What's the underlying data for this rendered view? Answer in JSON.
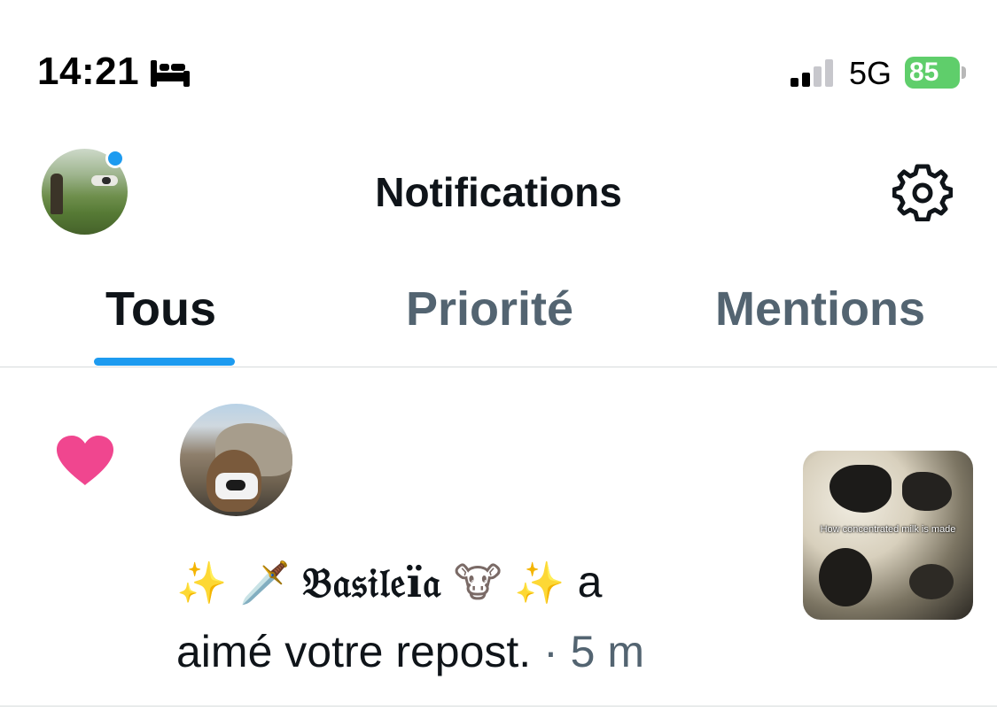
{
  "status_bar": {
    "time": "14:21",
    "sleep_icon": "bed-icon",
    "network": "5G",
    "battery_level": "85",
    "battery_color": "#5fce6b"
  },
  "header": {
    "title": "Notifications",
    "settings_icon": "gear-icon",
    "online_indicator_color": "#1d9bf0"
  },
  "tabs": [
    {
      "label": "Tous",
      "active": true
    },
    {
      "label": "Priorité",
      "active": false
    },
    {
      "label": "Mentions",
      "active": false
    }
  ],
  "notification": {
    "type_icon": "heart-icon",
    "type_color": "#f0468f",
    "emoji_sparkles": "✨",
    "emoji_dagger": "🗡️",
    "actor_name": "𝔅𝔞𝔰𝔦𝔩𝔢ï𝔞",
    "emoji_cow": "🐮",
    "action_a": "a",
    "action_rest": "aimé votre repost.",
    "separator": "·",
    "timestamp": "5 m",
    "media_caption": "How concentrated milk is made"
  },
  "colors": {
    "accent": "#1d9bf0",
    "text_primary": "#0f1419",
    "text_secondary": "#536471",
    "divider": "#d7dbdc"
  }
}
